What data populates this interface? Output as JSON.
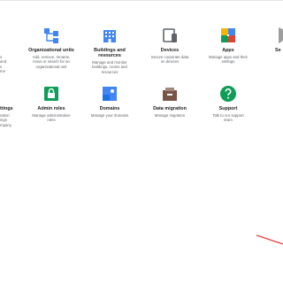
{
  "row1": [
    {
      "id": "partial-left-1",
      "label": "",
      "desc": "s\nand\ns\nme"
    },
    {
      "id": "organizational-units",
      "label": "Organizational units",
      "desc": "Add, remove, rename,\nmove or search for an\norganizational unit"
    },
    {
      "id": "buildings",
      "label": "Buildings and\nresources",
      "desc": "Manage and monitor\nbuildings, rooms and\nresources"
    },
    {
      "id": "devices",
      "label": "Devices",
      "desc": "Secure corporate data\non devices"
    },
    {
      "id": "apps",
      "label": "Apps",
      "desc": "Manage apps and their\nsettings"
    },
    {
      "id": "partial-right-1",
      "label": "Se",
      "desc": "Se\nse"
    }
  ],
  "row2": [
    {
      "id": "partial-left-2",
      "label": "ttings",
      "desc": "ration\nings\nmpany"
    },
    {
      "id": "admin-roles",
      "label": "Admin roles",
      "desc": "Manage administrative\nroles"
    },
    {
      "id": "domains",
      "label": "Domains",
      "desc": "Manage your domains"
    },
    {
      "id": "data-migration",
      "label": "Data migration",
      "desc": "Manage migration"
    },
    {
      "id": "support",
      "label": "Support",
      "desc": "Talk to our support\nteam"
    }
  ],
  "colors": {
    "blue": "#4285f4",
    "green": "#0f9d58",
    "red": "#db4437",
    "yellow": "#f4b400",
    "brown": "#795548",
    "annotation": "#e53935"
  }
}
